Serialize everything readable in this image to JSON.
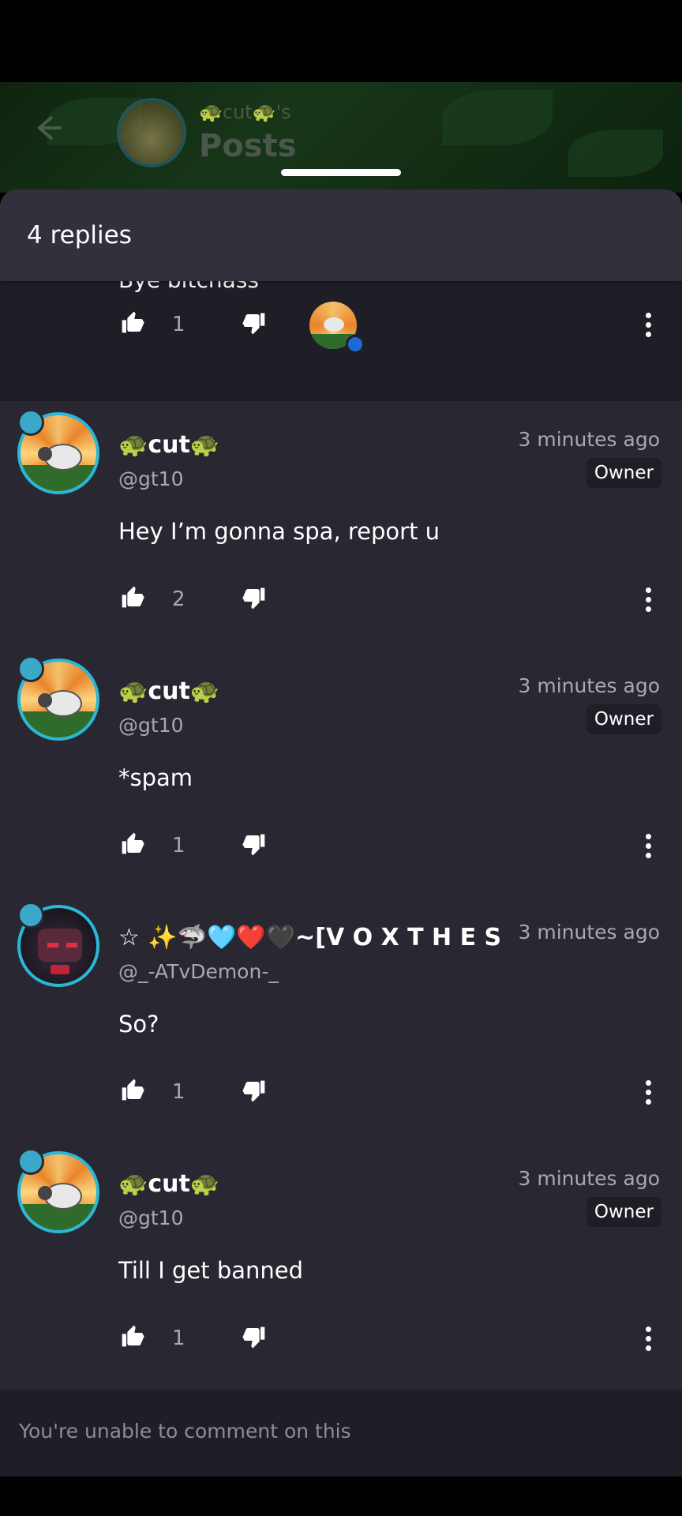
{
  "header": {
    "back_icon": "arrow-left-icon",
    "owner_label": "🐢cut🐢's",
    "title": "Posts"
  },
  "sheet": {
    "title": "4 replies"
  },
  "previous_post": {
    "text": "Bye bitchass",
    "likes": "1",
    "has_reactor_avatar": true
  },
  "replies": [
    {
      "name": "🐢cut🐢",
      "handle": "@gt10",
      "time": "3 minutes ago",
      "badge": "Owner",
      "text": "Hey I’m gonna spa, report u",
      "likes": "2",
      "avatar": "sheep"
    },
    {
      "name": "🐢cut🐢",
      "handle": "@gt10",
      "time": "3 minutes ago",
      "badge": "Owner",
      "text": "*spam",
      "likes": "1",
      "avatar": "sheep"
    },
    {
      "name": "☆ ✨🦈🩵❤️🖤~[V O X T H E S",
      "handle": "@_-ATvDemon-_",
      "time": "3 minutes ago",
      "badge": "",
      "text": "So?",
      "likes": "1",
      "avatar": "demon"
    },
    {
      "name": "🐢cut🐢",
      "handle": "@gt10",
      "time": "3 minutes ago",
      "badge": "Owner",
      "text": "Till I get banned",
      "likes": "1",
      "avatar": "sheep"
    }
  ],
  "footer": {
    "text": "You're unable to comment on this"
  },
  "colors": {
    "sheet_bg": "#292832",
    "sheet_header_bg": "#32313b",
    "muted_text": "#a9a8b1",
    "avatar_ring": "#2ab8d8"
  }
}
